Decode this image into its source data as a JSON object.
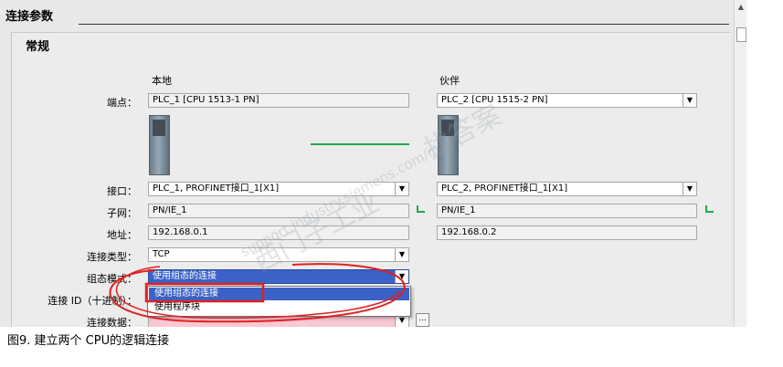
{
  "section_title": "连接参数",
  "general_title": "常规",
  "columns": {
    "local": "本地",
    "partner": "伙伴"
  },
  "rows": {
    "endpoint": {
      "label": "端点：",
      "local": "PLC_1 [CPU 1513-1 PN]",
      "partner": "PLC_2 [CPU 1515-2 PN]"
    },
    "interface": {
      "label": "接口：",
      "local": "PLC_1, PROFINET接口_1[X1]",
      "partner": "PLC_2, PROFINET接口_1[X1]"
    },
    "subnet": {
      "label": "子网：",
      "local": "PN/IE_1",
      "partner": "PN/IE_1"
    },
    "address": {
      "label": "地址：",
      "local": "192.168.0.1",
      "partner": "192.168.0.2"
    },
    "conn_type": {
      "label": "连接类型：",
      "value": "TCP"
    },
    "config_mode": {
      "label": "组态模式：",
      "value": "使用组态的连接"
    },
    "conn_id": {
      "label": "连接 ID（十进制）："
    },
    "conn_data": {
      "label": "连接数据：",
      "button": "..."
    }
  },
  "dropdown_options": [
    "使用组态的连接",
    "使用程序块"
  ],
  "dropdown_arrow": "▼",
  "scroll_up_arrow": "▲",
  "watermark": {
    "line1": "西门子工业",
    "line2": "support.industry.siemens.com/cs",
    "line3": "找答案"
  },
  "caption": "图9. 建立两个 CPU的逻辑连接",
  "colors": {
    "selected_blue": "#3a62c8",
    "network_green": "#1fa84a",
    "annotation_red": "#e02020",
    "error_pink": "#f8c8d4"
  },
  "icons": {
    "network": "network-icon",
    "device": "plc-device-icon"
  }
}
